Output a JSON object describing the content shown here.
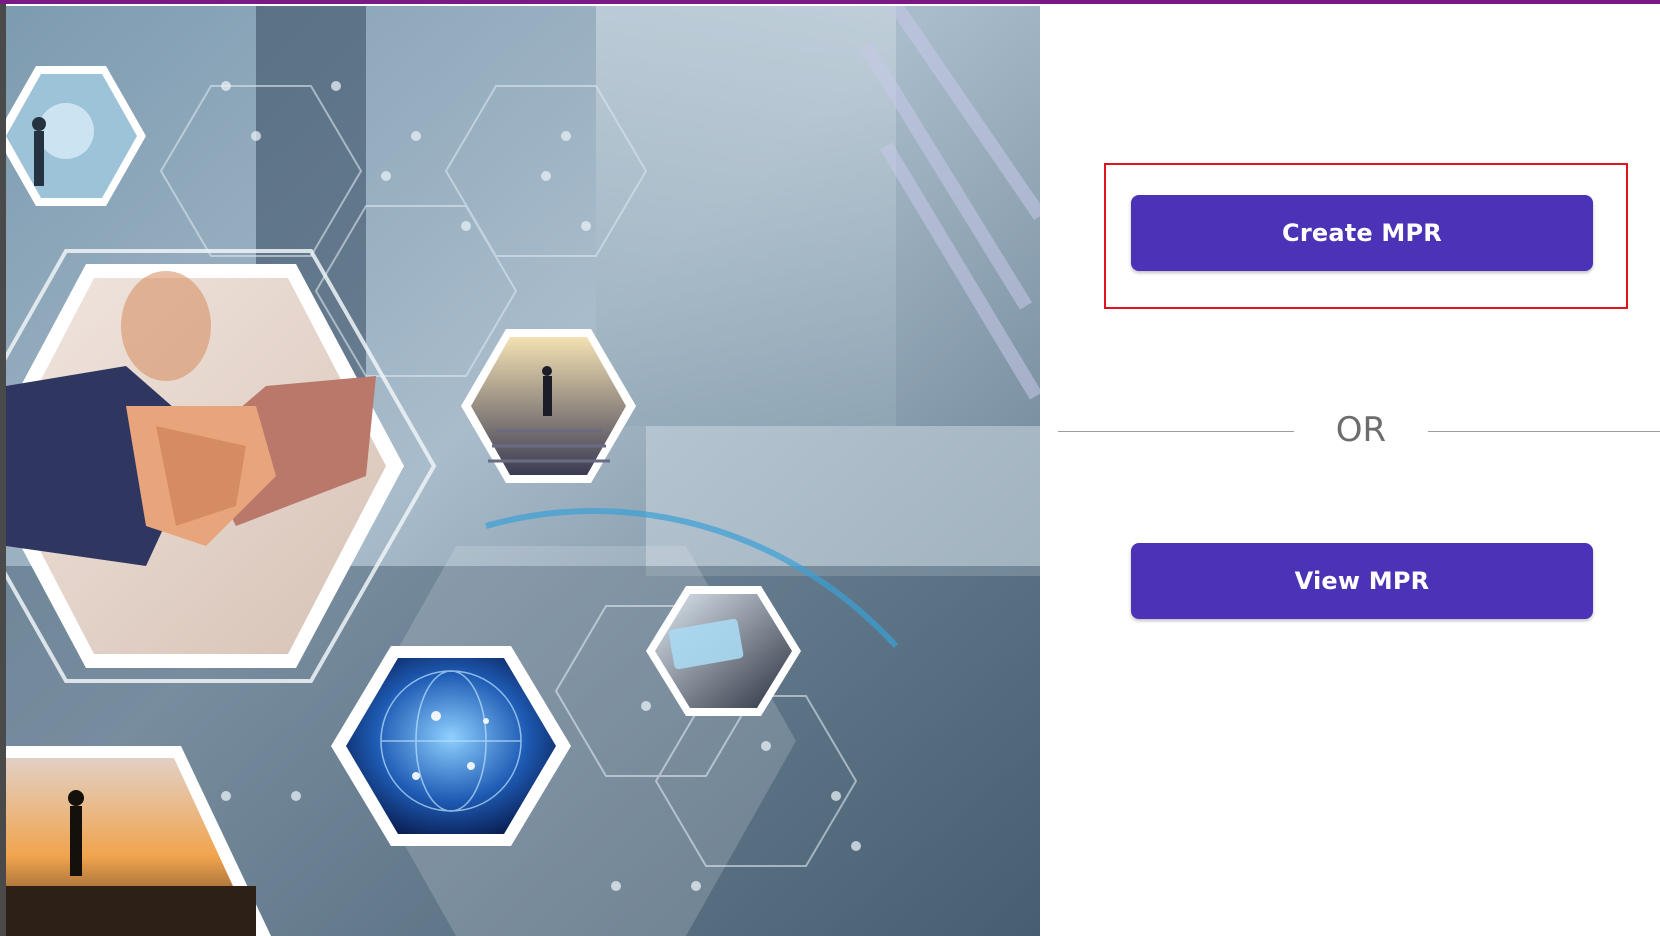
{
  "hero": {
    "image": "business-collaboration-hexagon-banner"
  },
  "actions": {
    "create_label": "Create MPR",
    "or_label": "OR",
    "view_label": "View MPR"
  },
  "colors": {
    "top_bar": "#7a1a86",
    "button": "#4b32b6",
    "button_text": "#ffffff",
    "highlight_border": "#e0141a",
    "divider": "#9c9c9c",
    "or_text": "#6d6d6d"
  }
}
